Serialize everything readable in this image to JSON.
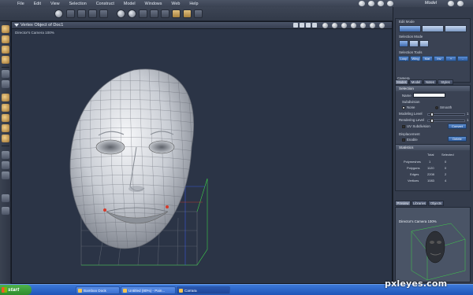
{
  "menubar": {
    "items": [
      "File",
      "Edit",
      "View",
      "Selection",
      "Construct",
      "Model",
      "Windows",
      "Web",
      "Help"
    ],
    "room_label": "Model"
  },
  "viewport": {
    "title": "Vertex Object of Doc1",
    "camera_label": "Director's Camera 100%"
  },
  "panel": {
    "edit_mode_label": "Edit Mode",
    "selection_mode_label": "Selection Mode",
    "selection_tools_label": "Selection Tools",
    "selection_tools": [
      "Loop",
      "Wing",
      "Mat",
      "Inv",
      "+",
      "-"
    ],
    "camera_label": "Camera",
    "tabs": [
      "Modes",
      "Model",
      "Notes",
      "Styles"
    ],
    "selection_header": "Selection",
    "name_label": "Name",
    "name_value": "",
    "subdivision_label": "Subdivision",
    "subdivision_options": [
      "None",
      "Smooth"
    ],
    "subdivision_selected": "Smooth",
    "modeling_level_label": "Modeling Level",
    "modeling_level_value": "1",
    "rendering_level_label": "Rendering Level",
    "rendering_level_value": "1",
    "uv_subdivision_label": "UV Subdivision",
    "uv_subdivision_checked": true,
    "convert_label": "Convert",
    "displacement_label": "Displacement",
    "enable_label": "Enable",
    "enable_checked": true,
    "delete_label": "Delete",
    "statistics_header": "Statistics",
    "stats_col_total": "Total",
    "stats_col_selected": "Selected",
    "stats": [
      {
        "label": "Polymeshes",
        "total": "1",
        "selected": "0"
      },
      {
        "label": "Polygons",
        "total": "1120",
        "selected": "0"
      },
      {
        "label": "Edges",
        "total": "2208",
        "selected": "2"
      },
      {
        "label": "Vertices",
        "total": "1083",
        "selected": "4"
      }
    ],
    "preview_tabs": [
      "Preview",
      "Libraries",
      "Objects"
    ],
    "preview_camera_label": "Director's Camera 100%"
  },
  "taskbar": {
    "start_label": "start",
    "tasks": [
      "Bamboo Dock",
      "Untitled (80%) - Pain...",
      "Carrara"
    ]
  },
  "watermark": "pxleyes.com",
  "colors": {
    "accent_blue": "#3f6bb0",
    "selection_red": "#d63a2a",
    "guide_green": "#3ecf4a"
  }
}
